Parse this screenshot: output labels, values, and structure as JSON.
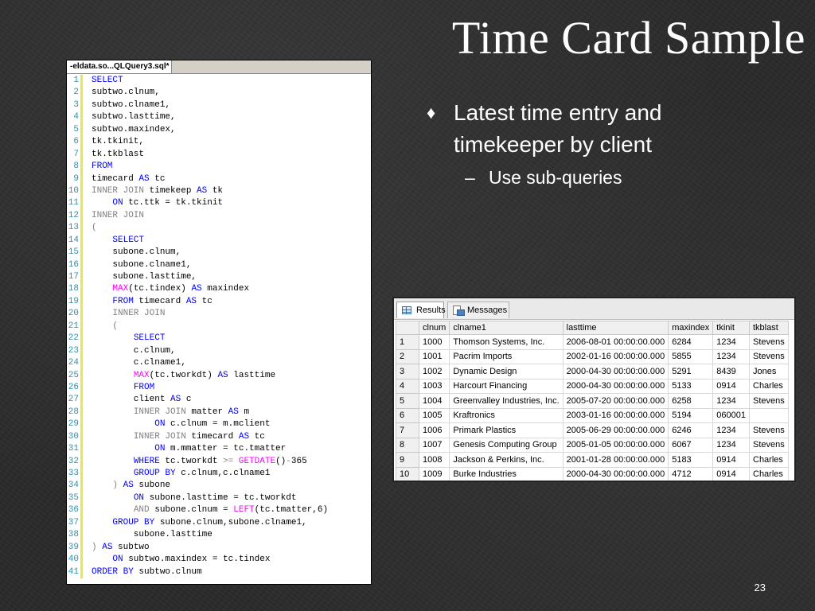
{
  "slide": {
    "title": "Time Card Sample",
    "bullet1": "Latest time entry and timekeeper by client",
    "bullet1_glyph": "♦",
    "bullet2": "Use sub-queries",
    "bullet2_glyph": "–",
    "page_number": "23"
  },
  "editor": {
    "tab_label": "-eldata.so...QLQuery3.sql*",
    "lines": [
      {
        "n": "1",
        "html": "<span class='k'>SELECT</span>"
      },
      {
        "n": "2",
        "html": "subtwo.clnum,"
      },
      {
        "n": "3",
        "html": "subtwo.clname1,"
      },
      {
        "n": "4",
        "html": "subtwo.lasttime,"
      },
      {
        "n": "5",
        "html": "subtwo.maxindex,"
      },
      {
        "n": "6",
        "html": "tk.tkinit,"
      },
      {
        "n": "7",
        "html": "tk.tkblast"
      },
      {
        "n": "8",
        "html": "<span class='k'>FROM</span>"
      },
      {
        "n": "9",
        "html": "timecard <span class='k'>AS</span> tc"
      },
      {
        "n": "10",
        "html": "<span class='g'>INNER JOIN</span> timekeep <span class='k'>AS</span> tk"
      },
      {
        "n": "11",
        "html": "    <span class='k'>ON</span> tc.ttk = tk.tkinit"
      },
      {
        "n": "12",
        "html": "<span class='g'>INNER JOIN</span>"
      },
      {
        "n": "13",
        "html": "<span class='g'>(</span>"
      },
      {
        "n": "14",
        "html": "    <span class='k'>SELECT</span>"
      },
      {
        "n": "15",
        "html": "    subone.clnum,"
      },
      {
        "n": "16",
        "html": "    subone.clname1,"
      },
      {
        "n": "17",
        "html": "    subone.lasttime,"
      },
      {
        "n": "18",
        "html": "    <span class='f'>MAX</span>(tc.tindex) <span class='k'>AS</span> maxindex"
      },
      {
        "n": "19",
        "html": "    <span class='k'>FROM</span> timecard <span class='k'>AS</span> tc"
      },
      {
        "n": "20",
        "html": "    <span class='g'>INNER JOIN</span>"
      },
      {
        "n": "21",
        "html": "    <span class='g'>(</span>"
      },
      {
        "n": "22",
        "html": "        <span class='k'>SELECT</span>"
      },
      {
        "n": "23",
        "html": "        c.clnum,"
      },
      {
        "n": "24",
        "html": "        c.clname1,"
      },
      {
        "n": "25",
        "html": "        <span class='f'>MAX</span>(tc.tworkdt) <span class='k'>AS</span> lasttime"
      },
      {
        "n": "26",
        "html": "        <span class='k'>FROM</span>"
      },
      {
        "n": "27",
        "html": "        client <span class='k'>AS</span> c"
      },
      {
        "n": "28",
        "html": "        <span class='g'>INNER JOIN</span> matter <span class='k'>AS</span> m"
      },
      {
        "n": "29",
        "html": "            <span class='k'>ON</span> c.clnum = m.mclient"
      },
      {
        "n": "30",
        "html": "        <span class='g'>INNER JOIN</span> timecard <span class='k'>AS</span> tc"
      },
      {
        "n": "31",
        "html": "            <span class='k'>ON</span> m.mmatter = tc.tmatter"
      },
      {
        "n": "32",
        "html": "        <span class='k'>WHERE</span> tc.tworkdt <span class='g'>&gt;=</span> <span class='f'>GETDATE</span>()<span class='g'>-</span>365"
      },
      {
        "n": "33",
        "html": "        <span class='k'>GROUP BY</span> c.clnum,c.clname1"
      },
      {
        "n": "34",
        "html": "    <span class='g'>)</span> <span class='k'>AS</span> subone"
      },
      {
        "n": "35",
        "html": "        <span class='k'>ON</span> subone.lasttime = tc.tworkdt"
      },
      {
        "n": "36",
        "html": "        <span class='g'>AND</span> subone.clnum = <span class='f'>LEFT</span>(tc.tmatter,6)"
      },
      {
        "n": "37",
        "html": "    <span class='k'>GROUP BY</span> subone.clnum,subone.clname1,"
      },
      {
        "n": "38",
        "html": "        subone.lasttime"
      },
      {
        "n": "39",
        "html": "<span class='g'>)</span> <span class='k'>AS</span> subtwo"
      },
      {
        "n": "40",
        "html": "    <span class='k'>ON</span> subtwo.maxindex = tc.tindex"
      },
      {
        "n": "41",
        "html": "<span class='k'>ORDER BY</span> subtwo.clnum"
      }
    ]
  },
  "results": {
    "tabs": [
      "Results",
      "Messages"
    ],
    "columns": [
      "",
      "clnum",
      "clname1",
      "lasttime",
      "maxindex",
      "tkinit",
      "tkblast"
    ],
    "rows": [
      [
        "1",
        "1000",
        "Thomson Systems, Inc.",
        "2006-08-01 00:00:00.000",
        "6284",
        "1234",
        "Stevens"
      ],
      [
        "2",
        "1001",
        "Pacrim Imports",
        "2002-01-16 00:00:00.000",
        "5855",
        "1234",
        "Stevens"
      ],
      [
        "3",
        "1002",
        "Dynamic Design",
        "2000-04-30 00:00:00.000",
        "5291",
        "8439",
        "Jones"
      ],
      [
        "4",
        "1003",
        "Harcourt Financing",
        "2000-04-30 00:00:00.000",
        "5133",
        "0914",
        "Charles"
      ],
      [
        "5",
        "1004",
        "Greenvalley Industries, Inc.",
        "2005-07-20 00:00:00.000",
        "6258",
        "1234",
        "Stevens"
      ],
      [
        "6",
        "1005",
        "Kraftronics",
        "2003-01-16 00:00:00.000",
        "5194",
        "060001",
        ""
      ],
      [
        "7",
        "1006",
        "Primark Plastics",
        "2005-06-29 00:00:00.000",
        "6246",
        "1234",
        "Stevens"
      ],
      [
        "8",
        "1007",
        "Genesis Computing Group",
        "2005-01-05 00:00:00.000",
        "6067",
        "1234",
        "Stevens"
      ],
      [
        "9",
        "1008",
        "Jackson &amp; Perkins, Inc.",
        "2001-01-28 00:00:00.000",
        "5183",
        "0914",
        "Charles"
      ],
      [
        "10",
        "1009",
        "Burke Industries",
        "2000-04-30 00:00:00.000",
        "4712",
        "0914",
        "Charles"
      ]
    ]
  }
}
